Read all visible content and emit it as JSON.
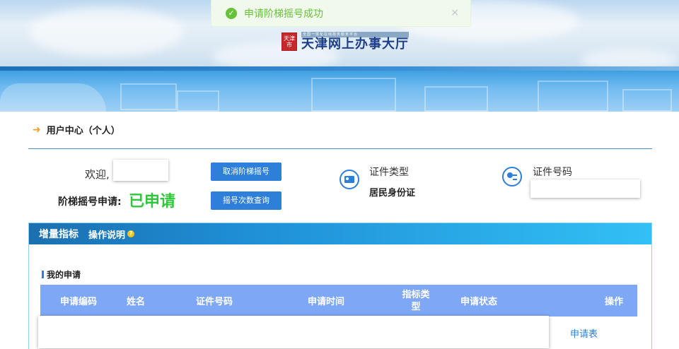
{
  "toast": {
    "message": "申请阶梯摇号成功",
    "close": "×"
  },
  "header": {
    "seal_text": "天津市",
    "subtitle": "全国一体化在线政务服务平台",
    "title": "天津网上办事大厅"
  },
  "user_center": {
    "title": "用户中心（个人）",
    "welcome_label": "欢迎,",
    "ladder_label": "阶梯摇号申请:",
    "ladder_status": "已申请",
    "cancel_button": "取消阶梯摇号",
    "query_button": "摇号次数查询",
    "id_type_label": "证件类型",
    "id_type_value": "居民身份证",
    "id_number_label": "证件号码"
  },
  "tabs": {
    "active": "增量指标",
    "help": "操作说明"
  },
  "my_applications": {
    "title": "我的申请",
    "columns": [
      "申请编码",
      "姓名",
      "证件号码",
      "申请时间",
      "指标类型",
      "申请状态",
      "操作"
    ],
    "rows": [
      {
        "action": "申请表"
      }
    ]
  },
  "colors": {
    "primary": "#2e7fd9",
    "success": "#2ec83a",
    "table_header": "#7ea8f5"
  }
}
